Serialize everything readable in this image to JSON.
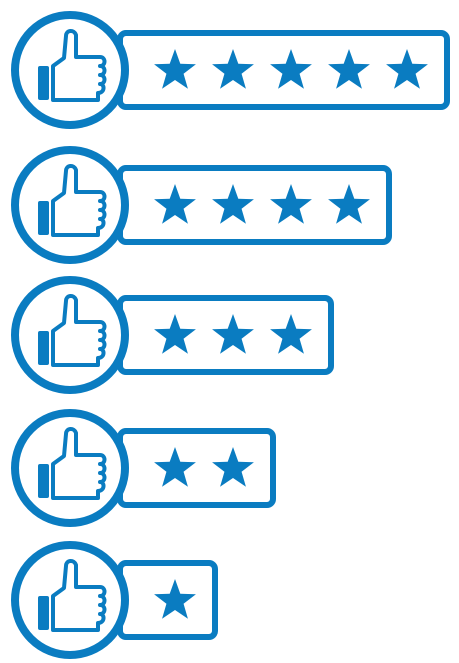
{
  "accent_color": "#0a7cc1",
  "icon": "thumbs-up-icon",
  "ratings": [
    {
      "stars": 5
    },
    {
      "stars": 4
    },
    {
      "stars": 3
    },
    {
      "stars": 2
    },
    {
      "stars": 1
    }
  ]
}
